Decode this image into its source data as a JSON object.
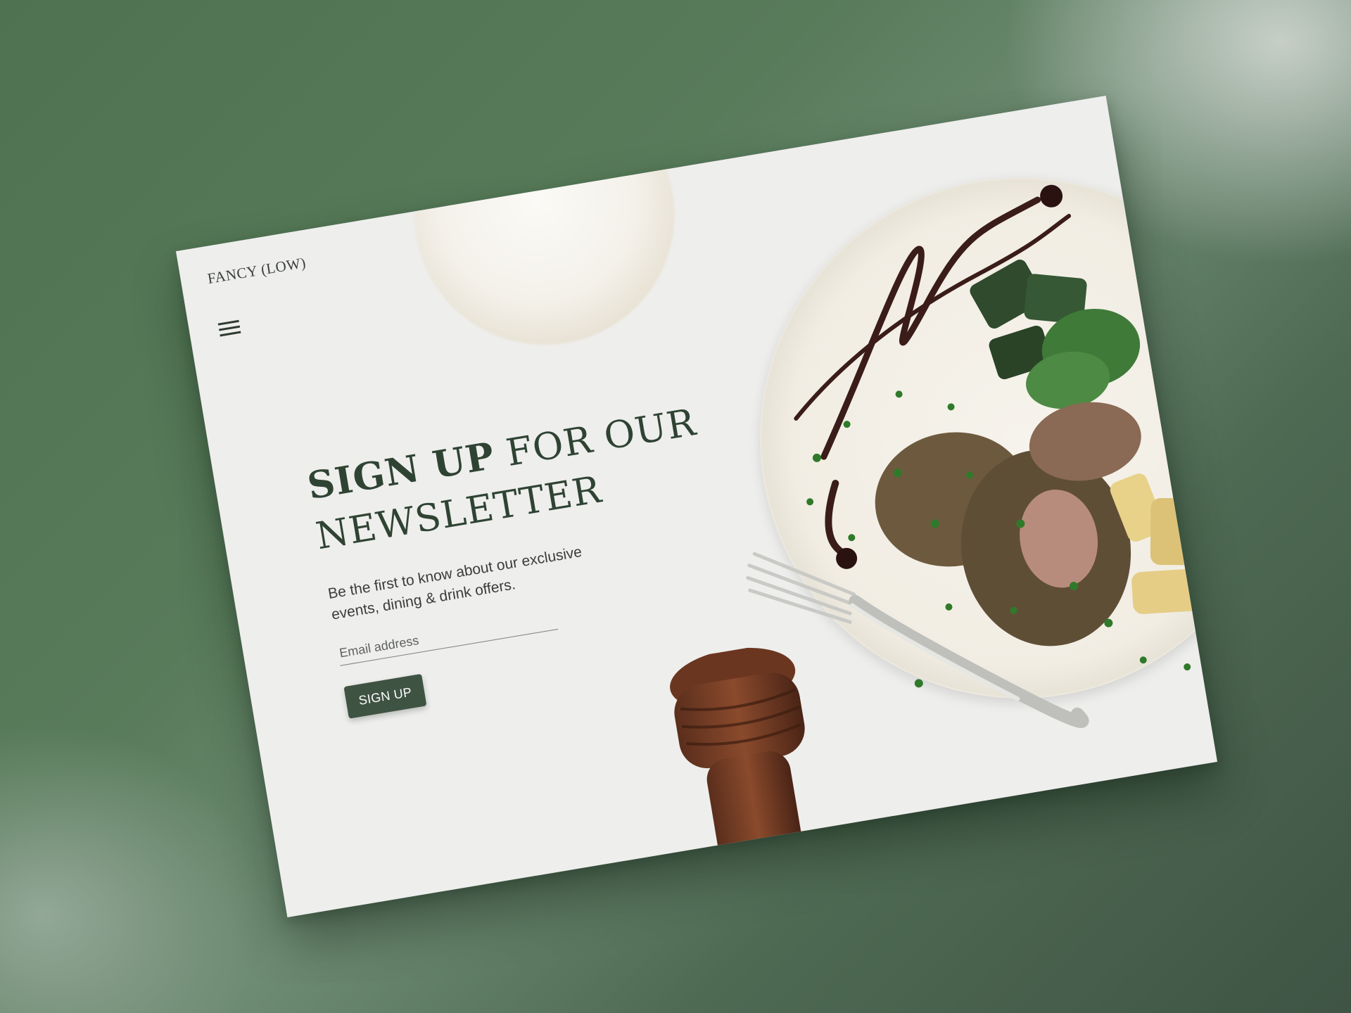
{
  "brand": {
    "name": "FANCY (LOW)"
  },
  "nav": {
    "menu_icon": "hamburger-menu-icon"
  },
  "hero": {
    "headline_strong": "SIGN UP",
    "headline_rest": " FOR OUR NEWSLETTER",
    "subtitle": "Be the first to know about our exclusive events, dining & drink offers.",
    "email_placeholder": "Email address",
    "email_value": "",
    "button_label": "SIGN UP"
  },
  "colors": {
    "accent": "#3f5342",
    "headline": "#2f4333",
    "background": "#eeeeec",
    "backdrop": "#587b5a"
  }
}
